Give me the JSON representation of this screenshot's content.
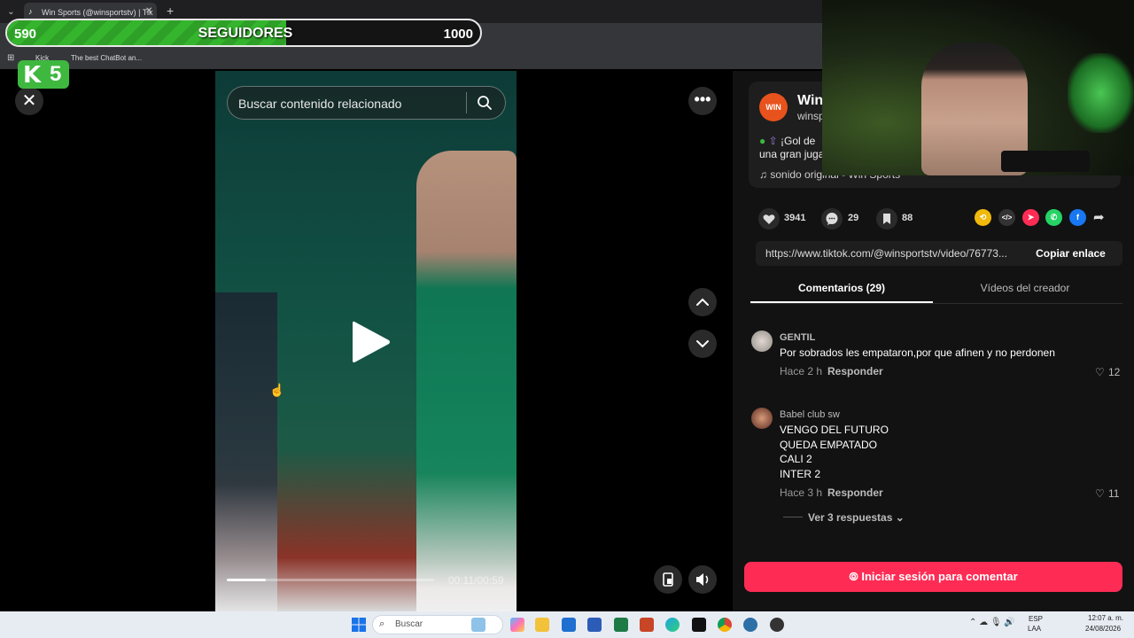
{
  "browser": {
    "tab_title": "Win Sports (@winsportstv) | Tik",
    "bookmarks": [
      {
        "label": "Kick"
      },
      {
        "label": "The best ChatBot an..."
      }
    ]
  },
  "overlay": {
    "goal_current": "590",
    "goal_label": "SEGUIDORES",
    "goal_target": "1000",
    "goal_progress": 0.59,
    "goal_color": "#35b52d",
    "kick_letter": "K",
    "kick_count": "5"
  },
  "video": {
    "search_placeholder": "Buscar contenido relacionado",
    "time_label": "00:11/00:59",
    "progress": 0.19
  },
  "creator": {
    "name": "Win",
    "handle": "winsp",
    "avatar_text": "WIN",
    "desc_line1": "¡Gol de",
    "desc_line2": "una gran juga",
    "sound": "sonido original - Win Sports"
  },
  "stats": {
    "likes": "3941",
    "comments": "29",
    "saves": "88"
  },
  "share": {
    "link": "https://www.tiktok.com/@winsportstv/video/76773...",
    "copy_label": "Copiar enlace"
  },
  "tabs": {
    "comments": "Comentarios (29)",
    "videos": "Vídeos del creador"
  },
  "comments": [
    {
      "user": "GENTIL",
      "lines": [
        "Por sobrados les empataron,por que afinen y no perdonen"
      ],
      "time": "Hace 2 h",
      "reply": "Responder",
      "likes": "12"
    },
    {
      "user": "Babel club sw",
      "lines": [
        "VENGO DEL FUTURO",
        "QUEDA EMPATADO",
        "CALI 2",
        "INTER 2"
      ],
      "time": "Hace 3 h",
      "reply": "Responder",
      "likes": "11",
      "replies_label": "Ver 3 respuestas"
    }
  ],
  "login_label": "Iniciar sesión para comentar",
  "taskbar": {
    "search_label": "Buscar",
    "lang1": "ESP",
    "lang2": "LAA",
    "time": "12:07 a. m.",
    "date": "24/08/2026"
  },
  "colors": {
    "accent": "#fe2c55",
    "kick_green": "#3fb83f",
    "brand_orange": "#e8521c"
  }
}
